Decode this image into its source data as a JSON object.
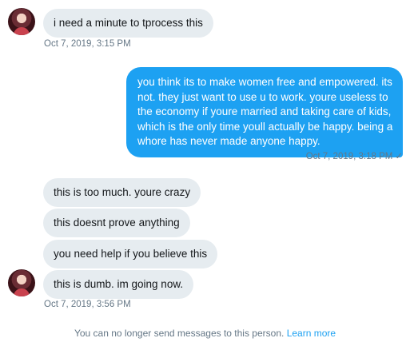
{
  "conversation": {
    "group1": {
      "message": "i need a minute to tprocess this",
      "timestamp": "Oct 7, 2019, 3:15 PM"
    },
    "sent": {
      "lines": [
        "you think its to make women free and empowered. its",
        "not. they just want to use u to work. youre useless to",
        "the economy if youre married and taking care of kids,",
        "which is the only time youll actually be happy. being a",
        "whore has never made anyone happy."
      ],
      "timestamp": "Oct 7, 2019, 3:18 PM",
      "status_icon": "checkmark-icon",
      "status_glyph": "✓"
    },
    "group2": {
      "messages": [
        "this is too much. youre crazy",
        "this doesnt prove anything",
        "you need help if you believe this",
        "this is dumb. im going now."
      ],
      "timestamp": "Oct 7, 2019, 3:56 PM"
    }
  },
  "footer": {
    "text": "You can no longer send messages to this person.",
    "link": "Learn more"
  },
  "colors": {
    "accent": "#1da1f2",
    "incoming_bubble": "#e6ecf0",
    "muted_text": "#657786"
  }
}
